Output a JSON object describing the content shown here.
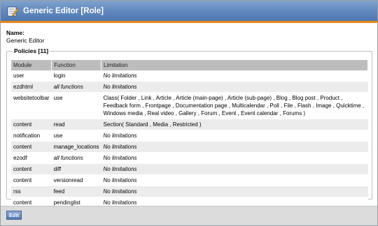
{
  "window": {
    "title": "Generic Editor [Role]",
    "icon": "document-edit-icon",
    "accent_color": "#e8891c",
    "titlebar_color": "#5f87bd"
  },
  "role": {
    "name_label": "Name:",
    "name_value": "Generic Editor"
  },
  "policies": {
    "legend": "Policies [11]",
    "headers": [
      "Module",
      "Function",
      "Limitation"
    ],
    "rows": [
      {
        "module": "user",
        "function": "login",
        "function_italic": false,
        "limitation": "No limitations",
        "limitation_italic": true
      },
      {
        "module": "ezdhtml",
        "function": "all functions",
        "function_italic": true,
        "limitation": "No limitations",
        "limitation_italic": true
      },
      {
        "module": "websitetoolbar",
        "function": "use",
        "function_italic": false,
        "limitation": "Class( Folder , Link , Article , Article (main-page) , Article (sub-page) , Blog , Blog post , Product , Feedback form , Frontpage , Documentation page , Multicalendar , Poll , File , Flash , Image , Quicktime , Windows media , Real video , Gallery , Forum , Event , Event calendar , Forums )",
        "limitation_italic": false
      },
      {
        "module": "content",
        "function": "read",
        "function_italic": false,
        "limitation": "Section( Standard , Media , Restricted )",
        "limitation_italic": false
      },
      {
        "module": "notification",
        "function": "use",
        "function_italic": false,
        "limitation": "No limitations",
        "limitation_italic": true
      },
      {
        "module": "content",
        "function": "manage_locations",
        "function_italic": false,
        "limitation": "No limitations",
        "limitation_italic": true
      },
      {
        "module": "ezodf",
        "function": "all functions",
        "function_italic": true,
        "limitation": "No limitations",
        "limitation_italic": true
      },
      {
        "module": "content",
        "function": "diff",
        "function_italic": false,
        "limitation": "No limitations",
        "limitation_italic": true
      },
      {
        "module": "content",
        "function": "versionread",
        "function_italic": false,
        "limitation": "No limitations",
        "limitation_italic": true
      },
      {
        "module": "rss",
        "function": "feed",
        "function_italic": false,
        "limitation": "No limitations",
        "limitation_italic": true
      },
      {
        "module": "content",
        "function": "pendinglist",
        "function_italic": false,
        "limitation": "No limitations",
        "limitation_italic": true
      }
    ]
  },
  "actions": {
    "edit_label": "Edit"
  }
}
